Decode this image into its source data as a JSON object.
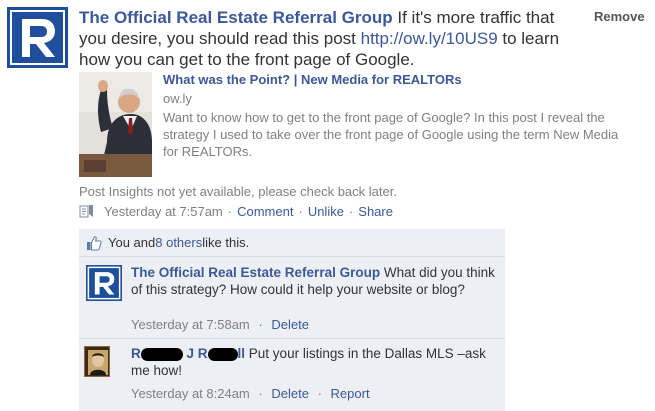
{
  "post": {
    "author": "The Official Real Estate Referral Group",
    "text": " If it's more traffic that you desire, you should read this post ",
    "link": "http://ow.ly/10US9",
    "text_after": " to learn how you can get to the front page of Google.",
    "remove_label": "Remove"
  },
  "attachment": {
    "title": "What was the Point? | New Media for REALTORs",
    "domain": "ow.ly",
    "description": "Want to know how to get to the front page of Google? In this post I reveal the strategy I used to take over the front page of Google using the term New Media for REALTORs."
  },
  "insights": "Post Insights not yet available, please check back later.",
  "meta": {
    "timestamp": "Yesterday at 7:57am",
    "actions": [
      "Comment",
      "Unlike",
      "Share"
    ],
    "separator": "·"
  },
  "likes": {
    "prefix": "You and ",
    "others": "8 others",
    "suffix": " like this."
  },
  "comments": [
    {
      "author": "The Official Real Estate Referral Group",
      "text": " What did you think of this strategy? How could it help your website or blog?",
      "timestamp": "Yesterday at 7:58am",
      "actions": [
        "Delete"
      ]
    },
    {
      "author_visible_start": "R",
      "author_visible_mid": "J R",
      "author_visible_end": "ll",
      "text": " Put your listings in the Dallas MLS –ask me how!",
      "timestamp": "Yesterday at 8:24am",
      "actions": [
        "Delete",
        "Report"
      ]
    }
  ],
  "icons": {
    "status": "status-update-icon",
    "like": "thumbs-up-icon",
    "logo": "realtor-r-logo"
  },
  "colors": {
    "link": "#3b5998",
    "feedback_bg": "#edeff4",
    "logo_blue": "#1f4f9c",
    "muted": "#808080"
  }
}
